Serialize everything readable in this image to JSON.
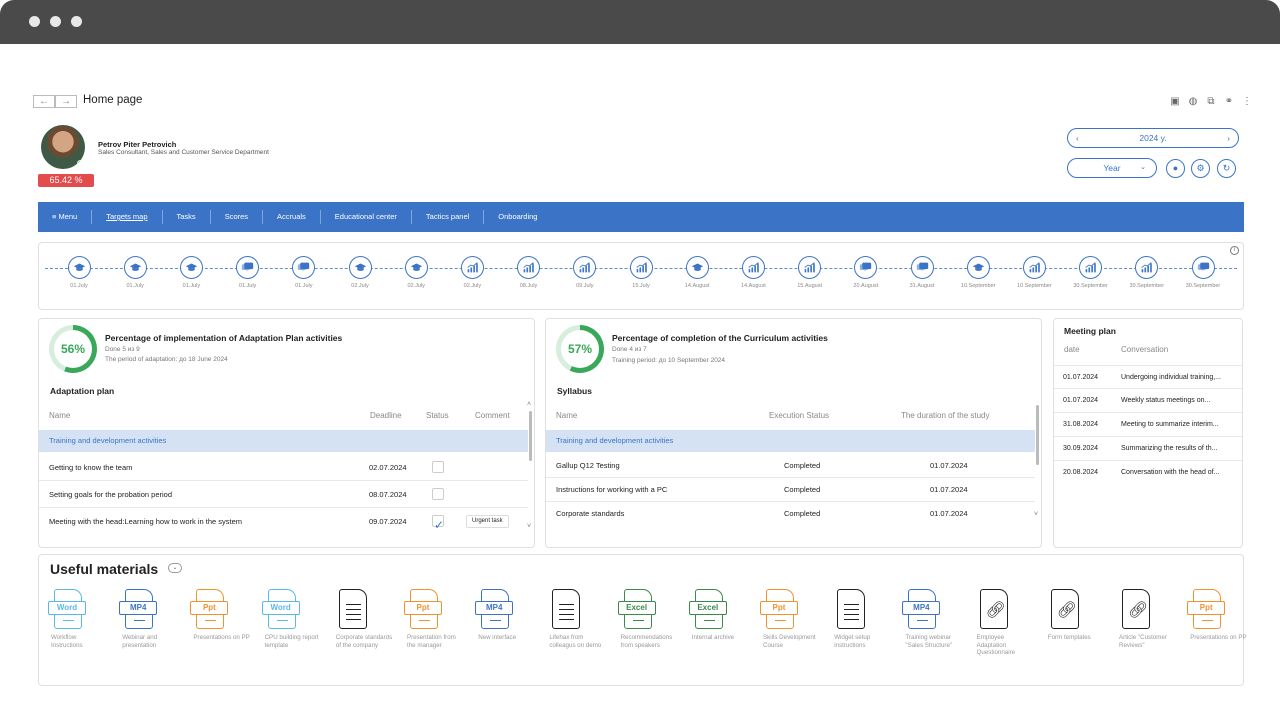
{
  "page": {
    "title": "Home page",
    "nav_back": "←",
    "nav_fwd": "→"
  },
  "top_icons": [
    "save-icon",
    "globe-icon",
    "search-document-icon",
    "link-icon",
    "more-icon"
  ],
  "user": {
    "name": "Petrov Piter Petrovich",
    "role": "Sales Consultant, Sales and Customer Service Department",
    "progress": "65.42 %"
  },
  "filters": {
    "year": "2024 y.",
    "year_prev": "‹",
    "year_next": "›",
    "period": "Year",
    "period_arrow": "⌄"
  },
  "menu": {
    "menu_label": "≡ Menu",
    "items": [
      "Targets map",
      "Tasks",
      "Scores",
      "Accruals",
      "Educational center",
      "Tactics panel",
      "Onboarding"
    ],
    "active": "Targets map"
  },
  "timeline": [
    {
      "icon": "graduation-cap-icon",
      "date": "01.July"
    },
    {
      "icon": "graduation-cap-icon",
      "date": "01.July"
    },
    {
      "icon": "graduation-cap-icon",
      "date": "01.July"
    },
    {
      "icon": "chat-icon",
      "date": "01.July"
    },
    {
      "icon": "chat-icon",
      "date": "01.July"
    },
    {
      "icon": "graduation-cap-icon",
      "date": "02.July"
    },
    {
      "icon": "graduation-cap-icon",
      "date": "02.July"
    },
    {
      "icon": "bar-chart-icon",
      "date": "02.July"
    },
    {
      "icon": "bar-chart-icon",
      "date": "08.July"
    },
    {
      "icon": "bar-chart-icon",
      "date": "09.July"
    },
    {
      "icon": "bar-chart-icon",
      "date": "15.July"
    },
    {
      "icon": "graduation-cap-icon",
      "date": "14.August"
    },
    {
      "icon": "bar-chart-icon",
      "date": "14.August"
    },
    {
      "icon": "bar-chart-icon",
      "date": "15.August"
    },
    {
      "icon": "chat-icon",
      "date": "20.August"
    },
    {
      "icon": "chat-icon",
      "date": "31.August"
    },
    {
      "icon": "graduation-cap-icon",
      "date": "10.September"
    },
    {
      "icon": "bar-chart-icon",
      "date": "10.September"
    },
    {
      "icon": "bar-chart-icon",
      "date": "30.September"
    },
    {
      "icon": "bar-chart-icon",
      "date": "30.September"
    },
    {
      "icon": "chat-icon",
      "date": "30.September"
    }
  ],
  "adaptation": {
    "percent": "56%",
    "percent_value": 56,
    "title": "Percentage of implementation of Adaptation Plan activities",
    "done": "Done 5 из 9",
    "period": "The period of adaptation: до 18 June 2024",
    "section": "Adaptation plan",
    "headers": {
      "name": "Name",
      "deadline": "Deadline",
      "status": "Status",
      "comment": "Comment"
    },
    "group": "Training and development activities",
    "rows": [
      {
        "name": "Getting to know the team",
        "deadline": "02.07.2024",
        "done": false,
        "comment": ""
      },
      {
        "name": "Setting goals for the probation period",
        "deadline": "08.07.2024",
        "done": false,
        "comment": ""
      },
      {
        "name": "Meeting with the head:Learning how to work in the system",
        "deadline": "09.07.2024",
        "done": true,
        "comment": "Urgent task"
      }
    ]
  },
  "curriculum": {
    "percent": "57%",
    "percent_value": 57,
    "title": "Percentage of completion of the Curriculum activities",
    "done": "Done 4 из 7",
    "period": "Training period: до 10 September 2024",
    "section": "Syllabus",
    "headers": {
      "name": "Name",
      "status": "Execution Status",
      "duration": "The duration of the study"
    },
    "group": "Training and development activities",
    "rows": [
      {
        "name": "Gallup Q12 Testing",
        "status": "Completed",
        "date": "01.07.2024"
      },
      {
        "name": "Instructions for working with a PC",
        "status": "Completed",
        "date": "01.07.2024"
      },
      {
        "name": "Corporate standards",
        "status": "Completed",
        "date": "01.07.2024"
      }
    ]
  },
  "meeting_plan": {
    "title": "Meeting plan",
    "headers": {
      "date": "date",
      "conversation": "Conversation"
    },
    "rows": [
      {
        "date": "01.07.2024",
        "conversation": "Undergoing individual training,..."
      },
      {
        "date": "01.07.2024",
        "conversation": "Weekly status meetings on..."
      },
      {
        "date": "31.08.2024",
        "conversation": "Meeting to summarize interim..."
      },
      {
        "date": "30.09.2024",
        "conversation": "Summarizing the results of th..."
      },
      {
        "date": "20.08.2024",
        "conversation": "Conversation with the head of..."
      }
    ]
  },
  "materials": {
    "title": "Useful materials",
    "toggle": "⌄",
    "items": [
      {
        "type": "Word",
        "color": "#5bb8e8",
        "label": "Workflow Instructions"
      },
      {
        "type": "MP4",
        "color": "#3b74c7",
        "label": "Webinar and presentation"
      },
      {
        "type": "Ppt",
        "color": "#f0922e",
        "label": "Presentations on PP"
      },
      {
        "type": "Word",
        "color": "#5bb8e8",
        "label": "CPU building report template"
      },
      {
        "type": "doc",
        "color": "#222222",
        "label": "Corporate standards of the company"
      },
      {
        "type": "Ppt",
        "color": "#f0922e",
        "label": "Presentation from the manager"
      },
      {
        "type": "MP4",
        "color": "#3b74c7",
        "label": "New interface"
      },
      {
        "type": "doc",
        "color": "#222222",
        "label": "Lifehax from colleagus on demo"
      },
      {
        "type": "Excel",
        "color": "#3a8a4a",
        "label": "Recommendations from speakers"
      },
      {
        "type": "Excel",
        "color": "#3a8a4a",
        "label": "Internal archive"
      },
      {
        "type": "Ppt",
        "color": "#f0922e",
        "label": "Skills Development Course"
      },
      {
        "type": "doc",
        "color": "#222222",
        "label": "Widget setup instructions"
      },
      {
        "type": "MP4",
        "color": "#3b74c7",
        "label": "Training webinar \"Sales Structure\""
      },
      {
        "type": "link",
        "color": "#222222",
        "label": "Employee Adaptation Questionnaire"
      },
      {
        "type": "link",
        "color": "#222222",
        "label": "Form templates"
      },
      {
        "type": "link",
        "color": "#222222",
        "label": "Article \"Customer Reviews\""
      },
      {
        "type": "Ppt",
        "color": "#f0922e",
        "label": "Presentations on PP"
      }
    ]
  }
}
